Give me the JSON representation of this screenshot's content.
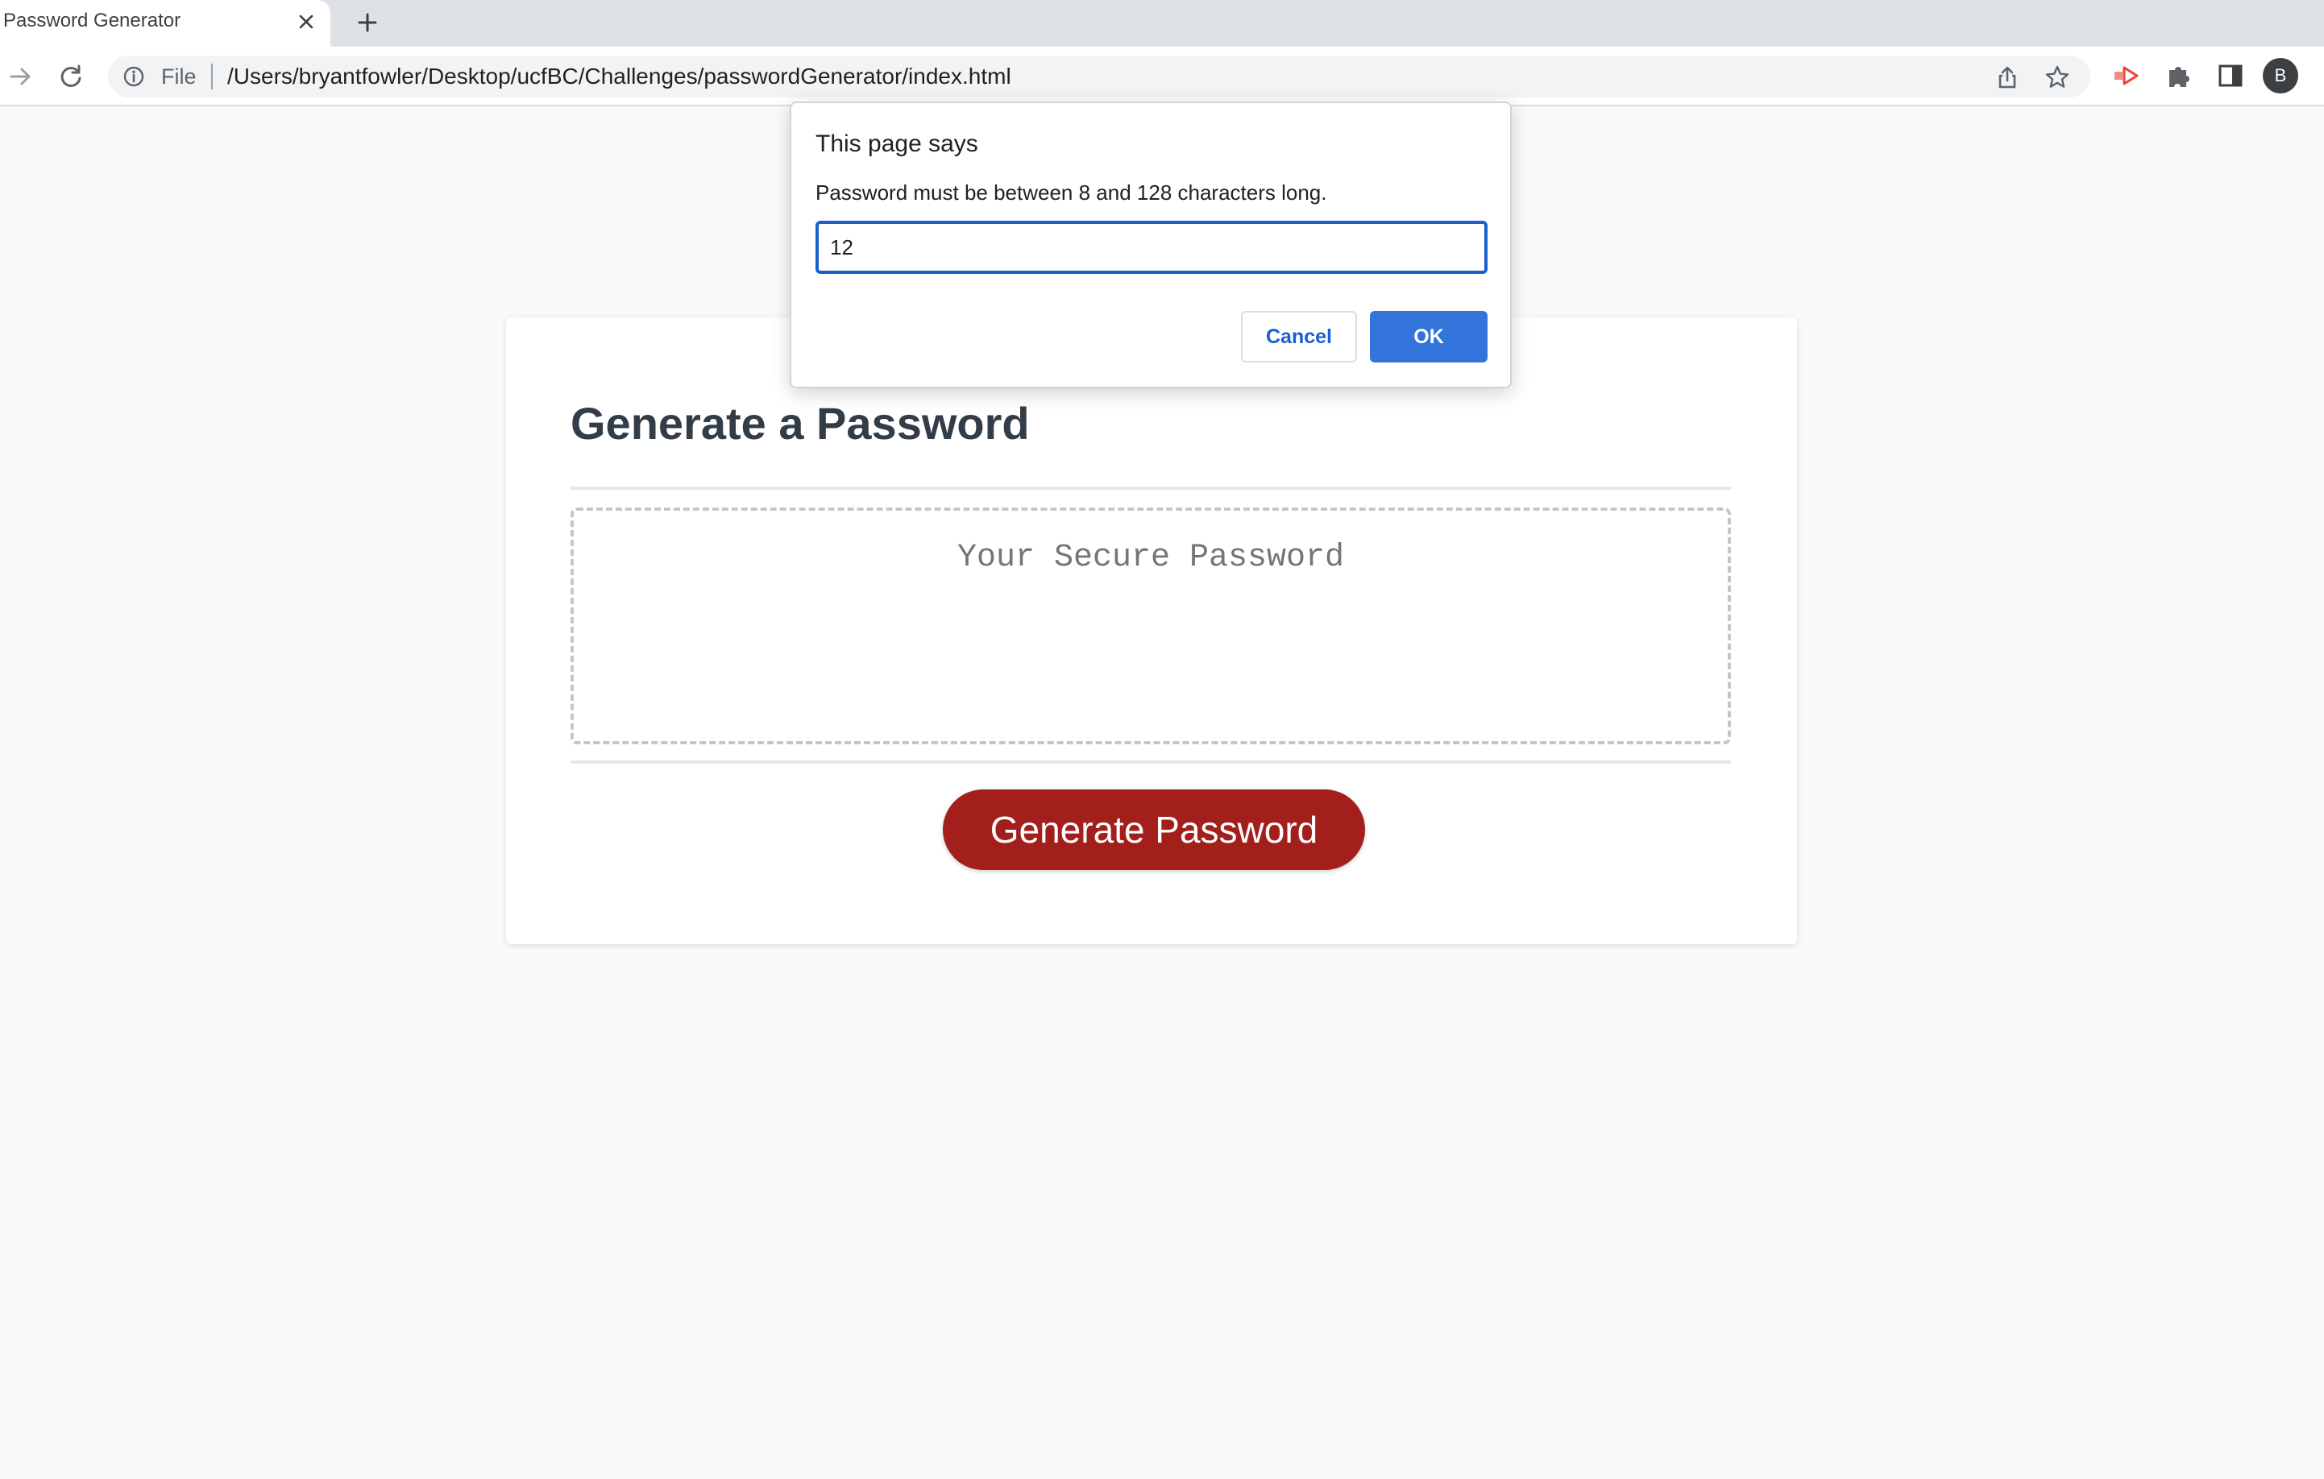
{
  "browser": {
    "tab": {
      "title": "Password Generator"
    },
    "address_bar": {
      "scheme_label": "File",
      "url": "/Users/bryantfowler/Desktop/ucfBC/Challenges/passwordGenerator/index.html"
    },
    "profile": {
      "initial": "B"
    },
    "icons": {
      "tab_close": "close-icon",
      "new_tab": "plus-icon",
      "forward": "forward-arrow-icon",
      "reload": "reload-icon",
      "site_info": "info-icon",
      "share": "share-icon",
      "bookmark": "star-icon",
      "extension": "extension-icon",
      "extensions_menu": "puzzle-icon",
      "side_panel": "side-panel-icon"
    }
  },
  "page": {
    "title": "Generate a Password",
    "password_placeholder": "Your Secure Password",
    "generate_button": "Generate Password",
    "colors": {
      "button": "#a21f1b",
      "title": "#333d47",
      "background": "#f9fafc"
    }
  },
  "dialog": {
    "title": "This page says",
    "message": "Password must be between 8 and 128 characters long.",
    "input_value": "12",
    "cancel_label": "Cancel",
    "ok_label": "OK",
    "colors": {
      "accent": "#3274d9"
    }
  }
}
